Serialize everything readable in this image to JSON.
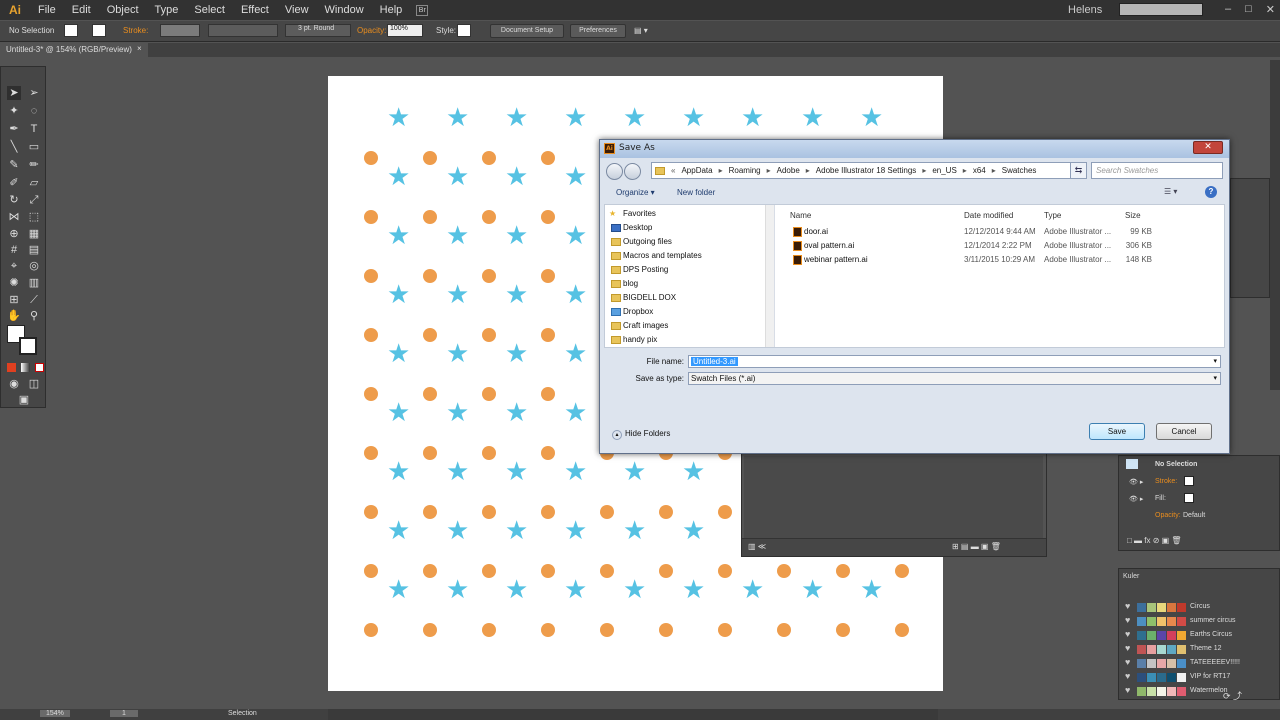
{
  "app": {
    "logo": "Ai",
    "user": "Helens"
  },
  "menubar": {
    "items": [
      "File",
      "Edit",
      "Object",
      "Type",
      "Select",
      "Effect",
      "View",
      "Window",
      "Help"
    ],
    "bridge": "Br"
  },
  "controlbar": {
    "selection": "No Selection",
    "stroke_label": "Stroke:",
    "brush": "3 pt. Round",
    "opacity_label": "Opacity:",
    "opacity_value": "100%",
    "style_label": "Style:",
    "doc_setup": "Document Setup",
    "preferences": "Preferences"
  },
  "document": {
    "tab_title": "Untitled-3* @ 154% (RGB/Preview)",
    "close": "×"
  },
  "artboard": {
    "star_color": "#56c2e3",
    "dot_color": "#ee9c4b"
  },
  "dialog": {
    "title": "Save As",
    "close": "✕",
    "breadcrumb": [
      "AppData",
      "Roaming",
      "Adobe",
      "Adobe Illustrator 18 Settings",
      "en_US",
      "x64",
      "Swatches"
    ],
    "breadcrumb_prefix": "«",
    "search_placeholder": "Search Swatches",
    "organize": "Organize ▾",
    "new_folder": "New folder",
    "tree": [
      "Favorites",
      "Desktop",
      "Outgoing files",
      "Macros and templates",
      "DPS Posting",
      "blog",
      "BIGDELL DOX",
      "Dropbox",
      "Craft images",
      "handy pix"
    ],
    "columns": {
      "name": "Name",
      "date": "Date modified",
      "type": "Type",
      "size": "Size"
    },
    "files": [
      {
        "name": "door.ai",
        "date": "12/12/2014 9:44 AM",
        "type": "Adobe Illustrator ...",
        "size": "99 KB"
      },
      {
        "name": "oval pattern.ai",
        "date": "12/1/2014 2:22 PM",
        "type": "Adobe Illustrator ...",
        "size": "306 KB"
      },
      {
        "name": "webinar pattern.ai",
        "date": "3/11/2015 10:29 AM",
        "type": "Adobe Illustrator ...",
        "size": "148 KB"
      }
    ],
    "filename_label": "File name:",
    "filename_value": "Untitled-3.ai",
    "savetype_label": "Save as type:",
    "savetype_value": "Swatch Files (*.ai)",
    "hide_folders": "Hide Folders",
    "save": "Save",
    "cancel": "Cancel"
  },
  "appearance": {
    "title": "No Selection",
    "stroke": "Stroke:",
    "fill": "Fill:",
    "opacity": "Opacity:",
    "opacity_value": "Default"
  },
  "kuler": {
    "title": "Kuler",
    "themes": [
      {
        "name": "Circus",
        "colors": [
          "#3c6f9c",
          "#a8c47a",
          "#e8d77c",
          "#d9763e",
          "#c0392b"
        ]
      },
      {
        "name": "summer circus",
        "colors": [
          "#4d8fc1",
          "#8fbf6a",
          "#f0c26b",
          "#e8894d",
          "#d24b46"
        ]
      },
      {
        "name": "Earths Circus",
        "colors": [
          "#2f6f8f",
          "#6bb06b",
          "#5b45a8",
          "#d43f5c",
          "#f0a832"
        ]
      },
      {
        "name": "Theme 12",
        "colors": [
          "#c05454",
          "#e8a0a0",
          "#a8d8d0",
          "#5fa8c2",
          "#e0c070"
        ]
      },
      {
        "name": "TATEEEEEV!!!!!",
        "colors": [
          "#5a7fa8",
          "#c4c4c4",
          "#e8a8a8",
          "#d8c0a8",
          "#4a8fc8"
        ]
      },
      {
        "name": "VIP for RT17",
        "colors": [
          "#2c4f7c",
          "#3b8fb5",
          "#2a6b8c",
          "#0f4f6f",
          "#f2f2f2"
        ]
      },
      {
        "name": "Watermelon",
        "colors": [
          "#8fb86a",
          "#c8e0a8",
          "#f4f4e8",
          "#f0b8b8",
          "#e05c70"
        ]
      }
    ]
  },
  "status": {
    "zoom": "154%",
    "page": "1",
    "tool": "Selection"
  }
}
